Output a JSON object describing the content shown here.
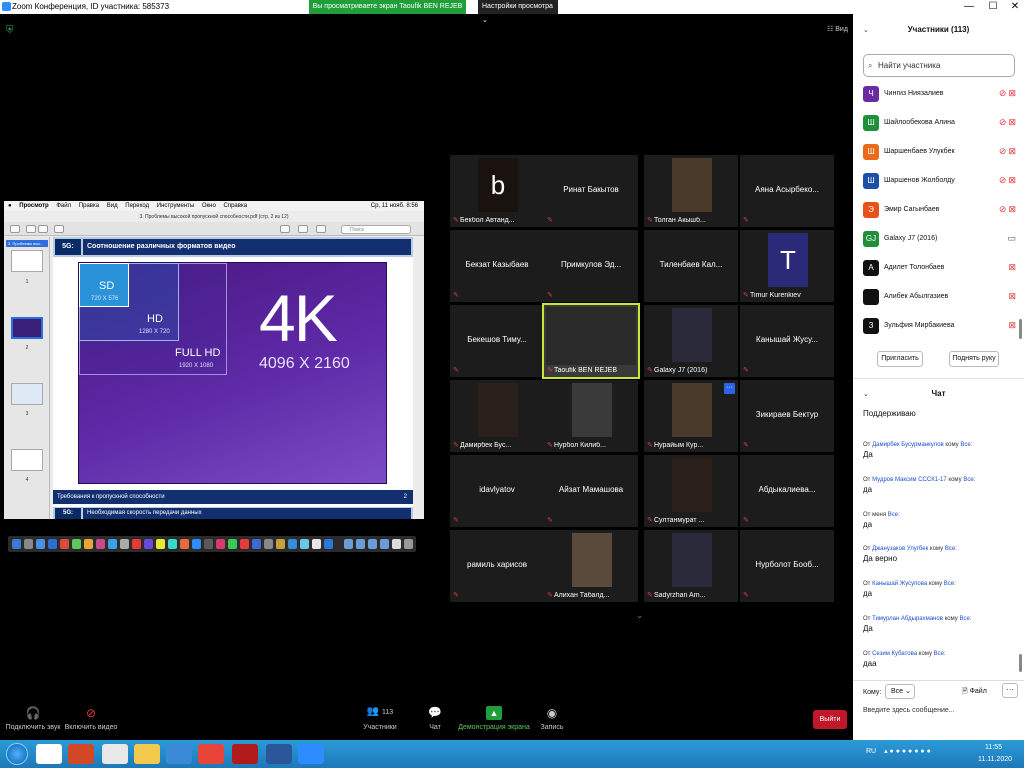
{
  "window": {
    "title": "Zoom Конференция, ID участника: 585373",
    "share_banner": "Вы просматриваете экран Taoufik BEN REJEB",
    "view_options": "Настройки просмотра",
    "view_button": "Вид",
    "controls": {
      "minimize": "—",
      "maximize": "☐",
      "close": "✕"
    }
  },
  "shared_screen": {
    "menubar": [
      "Просмотр",
      "Файл",
      "Правка",
      "Вид",
      "Переход",
      "Инструменты",
      "Окно",
      "Справка"
    ],
    "menubar_right": "Ср, 11 нояб.  8:56",
    "doc_title": "3. Проблемы высокой пропускной способности.pdf (стр. 2 из 12)",
    "search_placeholder": "Поиск",
    "sidebar_header": "3. Проблемы выс...",
    "thumb_numbers": [
      "1",
      "2",
      "3",
      "4"
    ],
    "slide": {
      "tag": "5G:",
      "title": "Соотношение различных форматов видео",
      "sd_label": "SD",
      "sd_res": "720 X 576",
      "hd_label": "HD",
      "hd_res": "1280 X 720",
      "fullhd_label": "FULL HD",
      "fullhd_res": "1920 X 1080",
      "k4_label": "4K",
      "k4_res": "4096 X 2160",
      "footer": "Требования к пропускной способности",
      "page": "2",
      "next_tag": "5G:",
      "next_title": "Необходимая скорость передачи данных"
    }
  },
  "video_grid": {
    "tiles": [
      {
        "name": "Бекбол Автанд...",
        "kind": "photo",
        "letter": "b"
      },
      {
        "name": "Ринат Бакытов",
        "kind": "name"
      },
      {
        "name": "Толган Акышб...",
        "kind": "photo"
      },
      {
        "name": "Аяна Асырбеко...",
        "kind": "name"
      },
      {
        "name": "Бекзат Казыбаев",
        "kind": "name"
      },
      {
        "name": "Примкулов Эд...",
        "kind": "name"
      },
      {
        "name": "Тиленбаев Кал...",
        "kind": "name"
      },
      {
        "name": "Timur Kurenkiev",
        "kind": "photo",
        "letter": "T"
      },
      {
        "name": "Бекешов Тиму...",
        "kind": "name"
      },
      {
        "name": "Taoufik BEN REJEB",
        "kind": "photo",
        "active": true
      },
      {
        "name": "Galaxy J7 (2016)",
        "kind": "photo"
      },
      {
        "name": "Канышай Жусу...",
        "kind": "name"
      },
      {
        "name": "Дамирбек Бус...",
        "kind": "photo"
      },
      {
        "name": "Нурбол Килиб...",
        "kind": "photo"
      },
      {
        "name": "Нурайым Кур...",
        "kind": "photo"
      },
      {
        "name": "Зикираев Бектур",
        "kind": "name"
      },
      {
        "name": "idavlyatov",
        "kind": "name"
      },
      {
        "name": "Айзат Мамашова",
        "kind": "name"
      },
      {
        "name": "Султанмурат ...",
        "kind": "photo"
      },
      {
        "name": "Абдыкалиева...",
        "kind": "name"
      },
      {
        "name": "рамиль харисов",
        "kind": "name"
      },
      {
        "name": "Алихан Табалд...",
        "kind": "photo"
      },
      {
        "name": "Sadyrzhan Am...",
        "kind": "photo"
      },
      {
        "name": "Нурболот Бооб...",
        "kind": "name"
      }
    ],
    "more_badge": "···"
  },
  "toolbar": {
    "audio": "Подключить звук",
    "video": "Включить видео",
    "participants": "Участники",
    "participants_count": "113",
    "chat": "Чат",
    "share": "Демонстрация экрана",
    "record": "Запись",
    "leave": "Выйти"
  },
  "participants_panel": {
    "title": "Участники (113)",
    "search_placeholder": "Найти участника",
    "items": [
      {
        "initial": "Ч",
        "name": "Чингиз Ниязалиев",
        "color": "#6a2ca0",
        "status": "muted"
      },
      {
        "initial": "Ш",
        "name": "Шайлообекова Алина",
        "color": "#1f8f3a",
        "status": "muted"
      },
      {
        "initial": "Ш",
        "name": "Шаршенбаев Улукбек",
        "color": "#e86a1a",
        "status": "muted"
      },
      {
        "initial": "Ш",
        "name": "Шаршенов Жолболду",
        "color": "#1d4fa8",
        "status": "muted"
      },
      {
        "initial": "Э",
        "name": "Эмир Сагынбаев",
        "color": "#e8521a",
        "status": "muted"
      },
      {
        "initial": "GJ",
        "name": "Galaxy J7 (2016)",
        "color": "#1f8f3a",
        "status": "video"
      },
      {
        "initial": "А",
        "name": "Адилет Толонбаев",
        "color": "#111111",
        "status": "novideo"
      },
      {
        "initial": "",
        "name": "Алибек Абылгазиев",
        "color": "#222222",
        "status": "novideo"
      },
      {
        "initial": "З",
        "name": "Зульфия Мирбакиева",
        "color": "#111111",
        "status": "novideo"
      }
    ],
    "invite": "Пригласить",
    "raise_hand": "Поднять руку"
  },
  "chat": {
    "title": "Чат",
    "from_word": "От",
    "to_word": "кому",
    "first_partial": "Поддерживаю",
    "messages": [
      {
        "from": "Дамирбек Бусурманкулов",
        "to": "Все:",
        "text": "Да"
      },
      {
        "from": "Мудров Максим СССК1-17",
        "to": "Все:",
        "text": "да"
      },
      {
        "from": "меня",
        "to": "Все:",
        "text": "да",
        "self": true
      },
      {
        "from": "Джанузаков Улугбек",
        "to": "Все:",
        "text": "Да верно"
      },
      {
        "from": "Канышай Жусупова",
        "to": "Все:",
        "text": "да"
      },
      {
        "from": "Тимурлан Абдырахманов",
        "to": "Все:",
        "text": "Да"
      },
      {
        "from": "Сезим Кубатова",
        "to": "Все:",
        "text": "даа"
      }
    ],
    "to_label": "Кому:",
    "to_value": "Все",
    "file_label": "Файл",
    "more": "···",
    "input_placeholder": "Введите здесь сообщение..."
  },
  "taskbar": {
    "lang": "RU",
    "time": "11:55",
    "date": "11.11.2020"
  }
}
